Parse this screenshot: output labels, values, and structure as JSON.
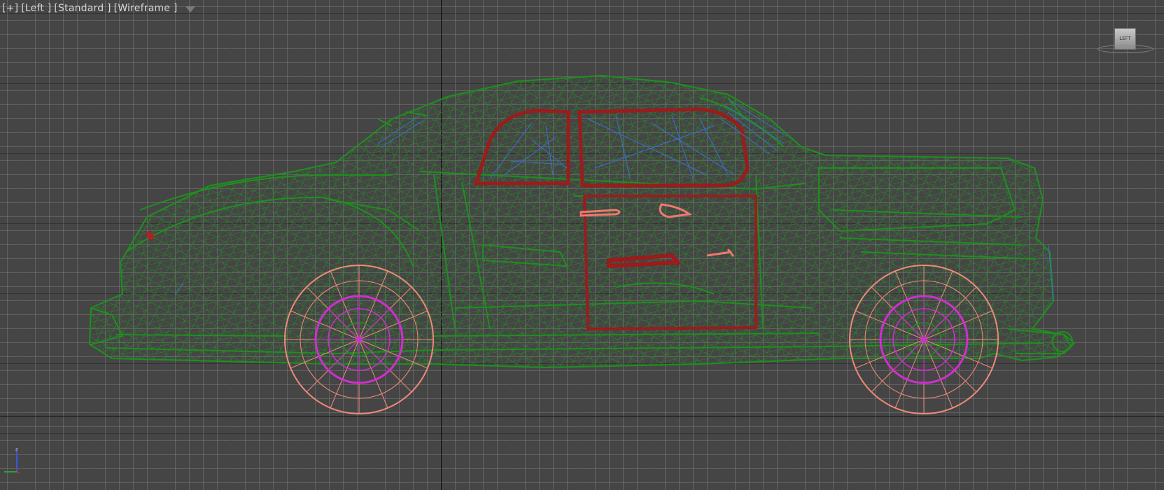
{
  "viewport": {
    "label_plus": "[+]",
    "label_view": "[Left ]",
    "label_shading": "[Standard ]",
    "label_mode": "[Wireframe ]",
    "viewcube_label": "LEFT"
  },
  "icons": {
    "filter": "filter-icon",
    "viewcube": "viewcube-icon",
    "axis_tripod": "axis-tripod-icon"
  },
  "colors": {
    "background": "#454545",
    "body_wire": "#1f8f1f",
    "door_frame": "#9a1c1c",
    "glass": "#3d6fd6",
    "tire": "#ef8a7a",
    "rim": "#d02fd0",
    "handle": "#ef7a6e"
  }
}
